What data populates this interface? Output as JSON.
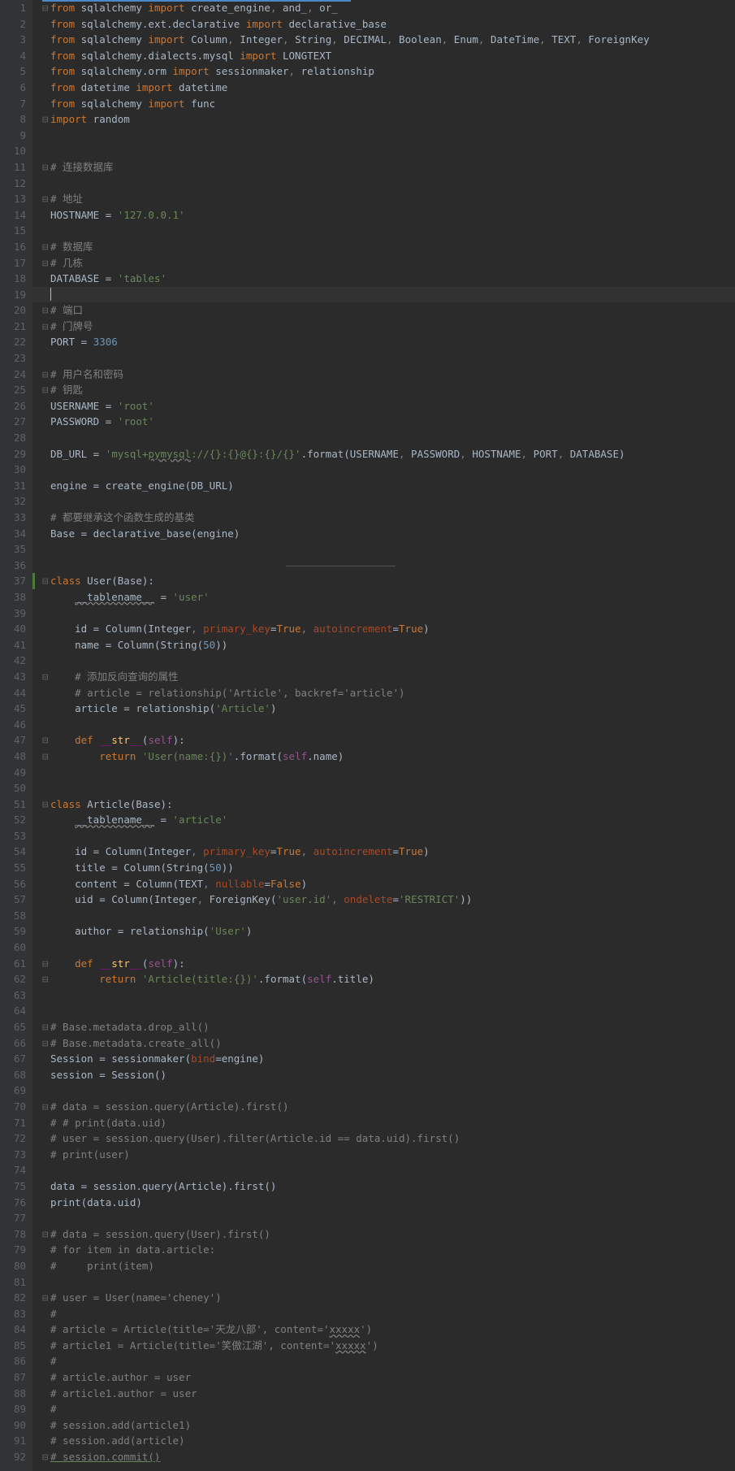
{
  "lines": [
    {
      "n": 1,
      "fold": "⊟",
      "tokens": [
        [
          "kw",
          "from"
        ],
        [
          "",
          " sqlalchemy "
        ],
        [
          "kw",
          "import"
        ],
        [
          "",
          " create_engine"
        ],
        [
          "cmt",
          ","
        ],
        [
          "",
          " and_"
        ],
        [
          "cmt",
          ","
        ],
        [
          "",
          " or_"
        ]
      ]
    },
    {
      "n": 2,
      "fold": "",
      "tokens": [
        [
          "kw",
          "from"
        ],
        [
          "",
          " sqlalchemy.ext.declarative "
        ],
        [
          "kw",
          "import"
        ],
        [
          "",
          " declarative_base"
        ]
      ]
    },
    {
      "n": 3,
      "fold": "",
      "tokens": [
        [
          "kw",
          "from"
        ],
        [
          "",
          " sqlalchemy "
        ],
        [
          "kw",
          "import"
        ],
        [
          "",
          " Column"
        ],
        [
          "cmt",
          ","
        ],
        [
          "",
          " Integer"
        ],
        [
          "cmt",
          ","
        ],
        [
          "",
          " String"
        ],
        [
          "cmt",
          ","
        ],
        [
          "",
          " DECIMAL"
        ],
        [
          "cmt",
          ","
        ],
        [
          "",
          " Boolean"
        ],
        [
          "cmt",
          ","
        ],
        [
          "",
          " Enum"
        ],
        [
          "cmt",
          ","
        ],
        [
          "",
          " DateTime"
        ],
        [
          "cmt",
          ","
        ],
        [
          "",
          " TEXT"
        ],
        [
          "cmt",
          ","
        ],
        [
          "",
          " ForeignKey"
        ]
      ]
    },
    {
      "n": 4,
      "fold": "",
      "tokens": [
        [
          "kw",
          "from"
        ],
        [
          "",
          " sqlalchemy.dialects.mysql "
        ],
        [
          "kw",
          "import"
        ],
        [
          "",
          " LONGTEXT"
        ]
      ]
    },
    {
      "n": 5,
      "fold": "",
      "tokens": [
        [
          "kw",
          "from"
        ],
        [
          "",
          " sqlalchemy.orm "
        ],
        [
          "kw",
          "import"
        ],
        [
          "",
          " sessionmaker"
        ],
        [
          "cmt",
          ","
        ],
        [
          "",
          " relationship"
        ]
      ]
    },
    {
      "n": 6,
      "fold": "",
      "tokens": [
        [
          "kw",
          "from"
        ],
        [
          "",
          " datetime "
        ],
        [
          "kw",
          "import"
        ],
        [
          "",
          " datetime"
        ]
      ]
    },
    {
      "n": 7,
      "fold": "",
      "tokens": [
        [
          "kw",
          "from"
        ],
        [
          "",
          " sqlalchemy "
        ],
        [
          "kw",
          "import"
        ],
        [
          "",
          " func"
        ]
      ]
    },
    {
      "n": 8,
      "fold": "⊟",
      "tokens": [
        [
          "kw",
          "import"
        ],
        [
          "",
          " random"
        ]
      ]
    },
    {
      "n": 9,
      "fold": "",
      "tokens": []
    },
    {
      "n": 10,
      "fold": "",
      "tokens": []
    },
    {
      "n": 11,
      "fold": "⊟",
      "tokens": [
        [
          "cmt",
          "# 连接数据库"
        ]
      ]
    },
    {
      "n": 12,
      "fold": "",
      "tokens": []
    },
    {
      "n": 13,
      "fold": "⊟",
      "tokens": [
        [
          "cmt",
          "# 地址"
        ]
      ]
    },
    {
      "n": 14,
      "fold": "",
      "tokens": [
        [
          "",
          "HOSTNAME = "
        ],
        [
          "str",
          "'127.0.0.1'"
        ]
      ]
    },
    {
      "n": 15,
      "fold": "",
      "tokens": []
    },
    {
      "n": 16,
      "fold": "⊟",
      "tokens": [
        [
          "cmt",
          "# 数据库"
        ]
      ]
    },
    {
      "n": 17,
      "fold": "⊟",
      "tokens": [
        [
          "cmt",
          "# 几栋"
        ]
      ]
    },
    {
      "n": 18,
      "fold": "",
      "tokens": [
        [
          "",
          "DATABASE = "
        ],
        [
          "str",
          "'tables'"
        ]
      ]
    },
    {
      "n": 19,
      "fold": "",
      "current": true,
      "cursor": true,
      "tokens": []
    },
    {
      "n": 20,
      "fold": "⊟",
      "tokens": [
        [
          "cmt",
          "# 端口"
        ]
      ]
    },
    {
      "n": 21,
      "fold": "⊟",
      "tokens": [
        [
          "cmt",
          "# 门牌号"
        ]
      ]
    },
    {
      "n": 22,
      "fold": "",
      "tokens": [
        [
          "",
          "PORT = "
        ],
        [
          "num",
          "3306"
        ]
      ]
    },
    {
      "n": 23,
      "fold": "",
      "tokens": []
    },
    {
      "n": 24,
      "fold": "⊟",
      "tokens": [
        [
          "cmt",
          "# 用户名和密码"
        ]
      ]
    },
    {
      "n": 25,
      "fold": "⊟",
      "tokens": [
        [
          "cmt",
          "# 钥匙"
        ]
      ]
    },
    {
      "n": 26,
      "fold": "",
      "tokens": [
        [
          "",
          "USERNAME = "
        ],
        [
          "str",
          "'root'"
        ]
      ]
    },
    {
      "n": 27,
      "fold": "",
      "tokens": [
        [
          "",
          "PASSWORD = "
        ],
        [
          "str",
          "'root'"
        ]
      ]
    },
    {
      "n": 28,
      "fold": "",
      "tokens": []
    },
    {
      "n": 29,
      "fold": "",
      "tokens": [
        [
          "",
          "DB_URL = "
        ],
        [
          "str",
          "'mysql+"
        ],
        [
          "str underline",
          "pymysql"
        ],
        [
          "str",
          "://{}:{}@{}:{}/{}'"
        ],
        [
          "",
          ".format(USERNAME"
        ],
        [
          "cmt",
          ","
        ],
        [
          "",
          " PASSWORD"
        ],
        [
          "cmt",
          ","
        ],
        [
          "",
          " HOSTNAME"
        ],
        [
          "cmt",
          ","
        ],
        [
          "",
          " PORT"
        ],
        [
          "cmt",
          ","
        ],
        [
          "",
          " DATABASE)"
        ]
      ]
    },
    {
      "n": 30,
      "fold": "",
      "tokens": []
    },
    {
      "n": 31,
      "fold": "",
      "tokens": [
        [
          "",
          "engine = create_engine(DB_URL)"
        ]
      ]
    },
    {
      "n": 32,
      "fold": "",
      "tokens": []
    },
    {
      "n": 33,
      "fold": "",
      "tokens": [
        [
          "cmt",
          "# 都要继承这个函数生成的基类"
        ]
      ]
    },
    {
      "n": 34,
      "fold": "",
      "tokens": [
        [
          "",
          "Base = declarative_base(engine)"
        ]
      ]
    },
    {
      "n": 35,
      "fold": "",
      "tokens": []
    },
    {
      "n": 36,
      "fold": "",
      "sep": true,
      "tokens": []
    },
    {
      "n": 37,
      "fold": "⊟",
      "mark": true,
      "tokens": [
        [
          "kw",
          "class "
        ],
        [
          "",
          "User(Base):"
        ]
      ]
    },
    {
      "n": 38,
      "fold": "",
      "tokens": [
        [
          "",
          "    "
        ],
        [
          "underline",
          "__tablename__"
        ],
        [
          "",
          " = "
        ],
        [
          "str",
          "'user'"
        ]
      ]
    },
    {
      "n": 39,
      "fold": "",
      "tokens": []
    },
    {
      "n": 40,
      "fold": "",
      "tokens": [
        [
          "",
          "    id = Column(Integer"
        ],
        [
          "cmt",
          ","
        ],
        [
          "",
          " "
        ],
        [
          "param",
          "primary_key"
        ],
        [
          "",
          "="
        ],
        [
          "kw",
          "True"
        ],
        [
          "cmt",
          ","
        ],
        [
          "",
          " "
        ],
        [
          "param",
          "autoincrement"
        ],
        [
          "",
          "="
        ],
        [
          "kw",
          "True"
        ],
        [
          "",
          ")"
        ]
      ]
    },
    {
      "n": 41,
      "fold": "",
      "tokens": [
        [
          "",
          "    name = Column(String("
        ],
        [
          "num",
          "50"
        ],
        [
          "",
          "))"
        ]
      ]
    },
    {
      "n": 42,
      "fold": "",
      "tokens": []
    },
    {
      "n": 43,
      "fold": "⊟",
      "tokens": [
        [
          "",
          "    "
        ],
        [
          "cmt",
          "# 添加反向查询的属性"
        ]
      ]
    },
    {
      "n": 44,
      "fold": "",
      "tokens": [
        [
          "",
          "    "
        ],
        [
          "cmt",
          "# article = relationship('Article', backref='article')"
        ]
      ]
    },
    {
      "n": 45,
      "fold": "",
      "tokens": [
        [
          "",
          "    article = relationship("
        ],
        [
          "str",
          "'Article'"
        ],
        [
          "",
          ")"
        ]
      ]
    },
    {
      "n": 46,
      "fold": "",
      "tokens": []
    },
    {
      "n": 47,
      "fold": "⊟",
      "tokens": [
        [
          "",
          "    "
        ],
        [
          "kw",
          "def "
        ],
        [
          "dunder",
          "__"
        ],
        [
          "fn",
          "str"
        ],
        [
          "dunder",
          "__"
        ],
        [
          "",
          "("
        ],
        [
          "self",
          "self"
        ],
        [
          "",
          "):"
        ]
      ]
    },
    {
      "n": 48,
      "fold": "⊟",
      "tokens": [
        [
          "",
          "        "
        ],
        [
          "kw",
          "return "
        ],
        [
          "str",
          "'User(name:{})'"
        ],
        [
          "",
          ".format("
        ],
        [
          "self",
          "self"
        ],
        [
          "",
          ".name)"
        ]
      ]
    },
    {
      "n": 49,
      "fold": "",
      "tokens": []
    },
    {
      "n": 50,
      "fold": "",
      "tokens": []
    },
    {
      "n": 51,
      "fold": "⊟",
      "tokens": [
        [
          "kw",
          "class "
        ],
        [
          "",
          "Article(Base):"
        ]
      ]
    },
    {
      "n": 52,
      "fold": "",
      "tokens": [
        [
          "",
          "    "
        ],
        [
          "underline",
          "__tablename__"
        ],
        [
          "",
          " = "
        ],
        [
          "str",
          "'article'"
        ]
      ]
    },
    {
      "n": 53,
      "fold": "",
      "tokens": []
    },
    {
      "n": 54,
      "fold": "",
      "tokens": [
        [
          "",
          "    id = Column(Integer"
        ],
        [
          "cmt",
          ","
        ],
        [
          "",
          " "
        ],
        [
          "param",
          "primary_key"
        ],
        [
          "",
          "="
        ],
        [
          "kw",
          "True"
        ],
        [
          "cmt",
          ","
        ],
        [
          "",
          " "
        ],
        [
          "param",
          "autoincrement"
        ],
        [
          "",
          "="
        ],
        [
          "kw",
          "True"
        ],
        [
          "",
          ")"
        ]
      ]
    },
    {
      "n": 55,
      "fold": "",
      "tokens": [
        [
          "",
          "    title = Column(String("
        ],
        [
          "num",
          "50"
        ],
        [
          "",
          "))"
        ]
      ]
    },
    {
      "n": 56,
      "fold": "",
      "tokens": [
        [
          "",
          "    content = Column(TEXT"
        ],
        [
          "cmt",
          ","
        ],
        [
          "",
          " "
        ],
        [
          "param",
          "nullable"
        ],
        [
          "",
          "="
        ],
        [
          "kw",
          "False"
        ],
        [
          "",
          ")"
        ]
      ]
    },
    {
      "n": 57,
      "fold": "",
      "tokens": [
        [
          "",
          "    uid = Column(Integer"
        ],
        [
          "cmt",
          ","
        ],
        [
          "",
          " ForeignKey("
        ],
        [
          "str",
          "'user.id'"
        ],
        [
          "cmt",
          ","
        ],
        [
          "",
          " "
        ],
        [
          "param",
          "ondelete"
        ],
        [
          "",
          "="
        ],
        [
          "str",
          "'RESTRICT'"
        ],
        [
          "",
          "))"
        ]
      ]
    },
    {
      "n": 58,
      "fold": "",
      "tokens": []
    },
    {
      "n": 59,
      "fold": "",
      "tokens": [
        [
          "",
          "    author = relationship("
        ],
        [
          "str",
          "'User'"
        ],
        [
          "",
          ")"
        ]
      ]
    },
    {
      "n": 60,
      "fold": "",
      "tokens": []
    },
    {
      "n": 61,
      "fold": "⊟",
      "tokens": [
        [
          "",
          "    "
        ],
        [
          "kw",
          "def "
        ],
        [
          "dunder",
          "__"
        ],
        [
          "fn",
          "str"
        ],
        [
          "dunder",
          "__"
        ],
        [
          "",
          "("
        ],
        [
          "self",
          "self"
        ],
        [
          "",
          "):"
        ]
      ]
    },
    {
      "n": 62,
      "fold": "⊟",
      "tokens": [
        [
          "",
          "        "
        ],
        [
          "kw",
          "return "
        ],
        [
          "str",
          "'Article(title:{})'"
        ],
        [
          "",
          ".format("
        ],
        [
          "self",
          "self"
        ],
        [
          "",
          ".title)"
        ]
      ]
    },
    {
      "n": 63,
      "fold": "",
      "tokens": []
    },
    {
      "n": 64,
      "fold": "",
      "tokens": []
    },
    {
      "n": 65,
      "fold": "⊟",
      "tokens": [
        [
          "cmt",
          "# Base.metadata.drop_all()"
        ]
      ]
    },
    {
      "n": 66,
      "fold": "⊟",
      "tokens": [
        [
          "cmt",
          "# Base.metadata.create_all()"
        ]
      ]
    },
    {
      "n": 67,
      "fold": "",
      "tokens": [
        [
          "",
          "Session = sessionmaker("
        ],
        [
          "param",
          "bind"
        ],
        [
          "",
          "=engine)"
        ]
      ]
    },
    {
      "n": 68,
      "fold": "",
      "tokens": [
        [
          "",
          "session = Session()"
        ]
      ]
    },
    {
      "n": 69,
      "fold": "",
      "tokens": []
    },
    {
      "n": 70,
      "fold": "⊟",
      "tokens": [
        [
          "cmt",
          "# data = session.query(Article).first()"
        ]
      ]
    },
    {
      "n": 71,
      "fold": "",
      "tokens": [
        [
          "cmt",
          "# # print(data.uid)"
        ]
      ]
    },
    {
      "n": 72,
      "fold": "",
      "tokens": [
        [
          "cmt",
          "# user = session.query(User).filter(Article.id == data.uid).first()"
        ]
      ]
    },
    {
      "n": 73,
      "fold": "",
      "tokens": [
        [
          "cmt",
          "# print(user)"
        ]
      ]
    },
    {
      "n": 74,
      "fold": "",
      "tokens": []
    },
    {
      "n": 75,
      "fold": "",
      "tokens": [
        [
          "",
          "data = session.query(Article).first()"
        ]
      ]
    },
    {
      "n": 76,
      "fold": "",
      "tokens": [
        [
          "",
          "print(data.uid)"
        ]
      ]
    },
    {
      "n": 77,
      "fold": "",
      "tokens": []
    },
    {
      "n": 78,
      "fold": "⊟",
      "tokens": [
        [
          "cmt",
          "# data = session.query(User).first()"
        ]
      ]
    },
    {
      "n": 79,
      "fold": "",
      "tokens": [
        [
          "cmt",
          "# for item in data.article:"
        ]
      ]
    },
    {
      "n": 80,
      "fold": "",
      "tokens": [
        [
          "cmt",
          "#     print(item)"
        ]
      ]
    },
    {
      "n": 81,
      "fold": "",
      "tokens": []
    },
    {
      "n": 82,
      "fold": "⊟",
      "tokens": [
        [
          "cmt",
          "# user = User(name='cheney')"
        ]
      ]
    },
    {
      "n": 83,
      "fold": "",
      "tokens": [
        [
          "cmt",
          "#"
        ]
      ]
    },
    {
      "n": 84,
      "fold": "",
      "tokens": [
        [
          "cmt",
          "# article = Article(title='天龙八部', content='"
        ],
        [
          "cmt underline",
          "xxxxx"
        ],
        [
          "cmt",
          "')"
        ]
      ]
    },
    {
      "n": 85,
      "fold": "",
      "tokens": [
        [
          "cmt",
          "# article1 = Article(title='笑傲江湖', content='"
        ],
        [
          "cmt underline",
          "xxxxx"
        ],
        [
          "cmt",
          "')"
        ]
      ]
    },
    {
      "n": 86,
      "fold": "",
      "tokens": [
        [
          "cmt",
          "#"
        ]
      ]
    },
    {
      "n": 87,
      "fold": "",
      "tokens": [
        [
          "cmt",
          "# article.author = user"
        ]
      ]
    },
    {
      "n": 88,
      "fold": "",
      "tokens": [
        [
          "cmt",
          "# article1.author = user"
        ]
      ]
    },
    {
      "n": 89,
      "fold": "",
      "tokens": [
        [
          "cmt",
          "#"
        ]
      ]
    },
    {
      "n": 90,
      "fold": "",
      "tokens": [
        [
          "cmt",
          "# session.add(article1)"
        ]
      ]
    },
    {
      "n": 91,
      "fold": "",
      "tokens": [
        [
          "cmt",
          "# session.add(article)"
        ]
      ]
    },
    {
      "n": 92,
      "fold": "⊟",
      "tokens": [
        [
          "cmt greenline",
          "# session.commit()"
        ]
      ]
    }
  ]
}
